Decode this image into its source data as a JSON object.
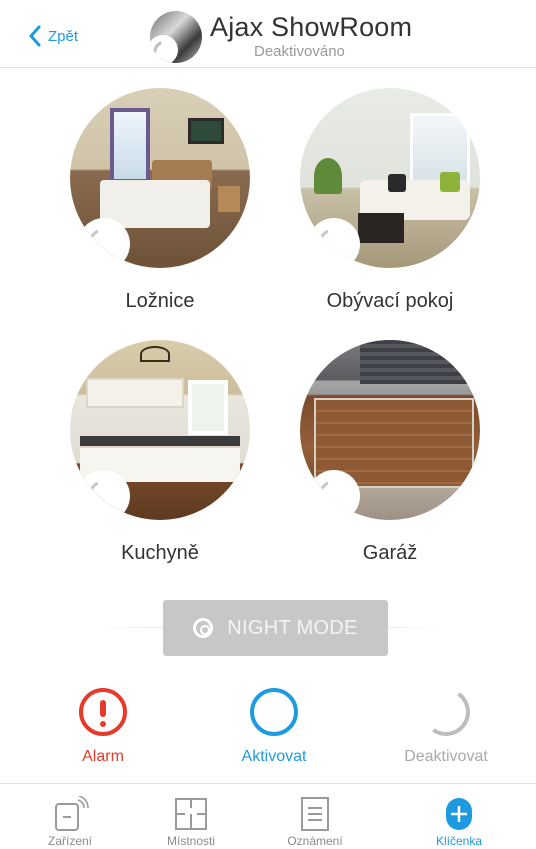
{
  "header": {
    "back_label": "Zpět",
    "title": "Ajax ShowRoom",
    "subtitle": "Deaktivováno"
  },
  "rooms": [
    {
      "name": "Ložnice",
      "image": "bedroom"
    },
    {
      "name": "Obývací pokoj",
      "image": "living-room"
    },
    {
      "name": "Kuchyně",
      "image": "kitchen"
    },
    {
      "name": "Garáž",
      "image": "garage"
    }
  ],
  "night_mode": {
    "label": "NIGHT MODE"
  },
  "security": {
    "alarm_label": "Alarm",
    "arm_label": "Aktivovat",
    "disarm_label": "Deaktivovat"
  },
  "tabs": [
    {
      "label": "Zařízení",
      "icon": "devices-icon",
      "active": false
    },
    {
      "label": "Místnosti",
      "icon": "rooms-icon",
      "active": false
    },
    {
      "label": "Oznámení",
      "icon": "notifications-icon",
      "active": false
    },
    {
      "label": "Klíčenka",
      "icon": "keyfob-icon",
      "active": true
    }
  ],
  "colors": {
    "accent": "#1e9be0",
    "alarm": "#e53a2c",
    "inactive": "#bdbdbd"
  }
}
